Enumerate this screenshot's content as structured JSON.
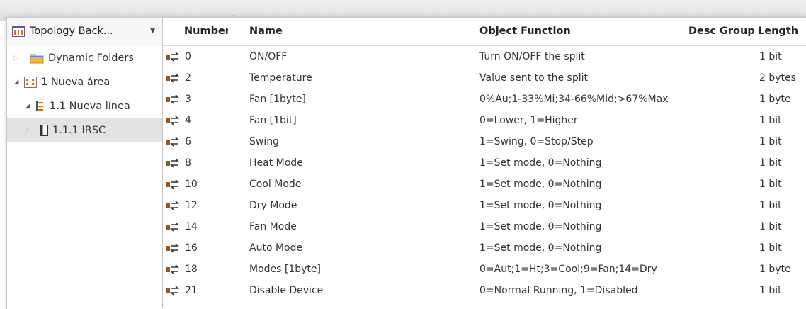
{
  "tree": {
    "header_title": "Topology Back...",
    "dropdown_glyph": "▼",
    "items": [
      {
        "label": "Dynamic Folders",
        "icon": "folder-icon",
        "expander": "▷"
      },
      {
        "label": "1 Nueva área",
        "icon": "area-icon",
        "expander": "◢"
      },
      {
        "label": "1.1 Nueva línea",
        "icon": "line-icon",
        "expander": "◢"
      },
      {
        "label": "1.1.1 IRSC",
        "icon": "device-icon",
        "expander": "▷"
      }
    ]
  },
  "table": {
    "columns": {
      "number": "Number",
      "name": "Name",
      "function": "Object Function",
      "description": "Description",
      "group": "Group Addresses",
      "length": "Length"
    },
    "sort_glyph": "˄",
    "rows": [
      {
        "number": "0",
        "name": "ON/OFF",
        "function": "Turn ON/OFF the split",
        "length": "1 bit"
      },
      {
        "number": "2",
        "name": "Temperature",
        "function": "Value sent to the split",
        "length": "2 bytes"
      },
      {
        "number": "3",
        "name": "Fan [1byte]",
        "function": "0%Au;1-33%Mi;34-66%Mid;>67%Max",
        "length": "1 byte"
      },
      {
        "number": "4",
        "name": "Fan [1bit]",
        "function": "0=Lower, 1=Higher",
        "length": "1 bit"
      },
      {
        "number": "6",
        "name": "Swing",
        "function": "1=Swing, 0=Stop/Step",
        "length": "1 bit"
      },
      {
        "number": "8",
        "name": "Heat Mode",
        "function": "1=Set mode, 0=Nothing",
        "length": "1 bit"
      },
      {
        "number": "10",
        "name": "Cool Mode",
        "function": "1=Set mode, 0=Nothing",
        "length": "1 bit"
      },
      {
        "number": "12",
        "name": "Dry Mode",
        "function": "1=Set mode, 0=Nothing",
        "length": "1 bit"
      },
      {
        "number": "14",
        "name": "Fan Mode",
        "function": "1=Set mode, 0=Nothing",
        "length": "1 bit"
      },
      {
        "number": "16",
        "name": "Auto Mode",
        "function": "1=Set mode, 0=Nothing",
        "length": "1 bit"
      },
      {
        "number": "18",
        "name": "Modes [1byte]",
        "function": "0=Aut;1=Ht;3=Cool;9=Fan;14=Dry",
        "length": "1 byte"
      },
      {
        "number": "21",
        "name": "Disable Device",
        "function": "0=Normal Running, 1=Disabled",
        "length": "1 bit"
      }
    ]
  }
}
